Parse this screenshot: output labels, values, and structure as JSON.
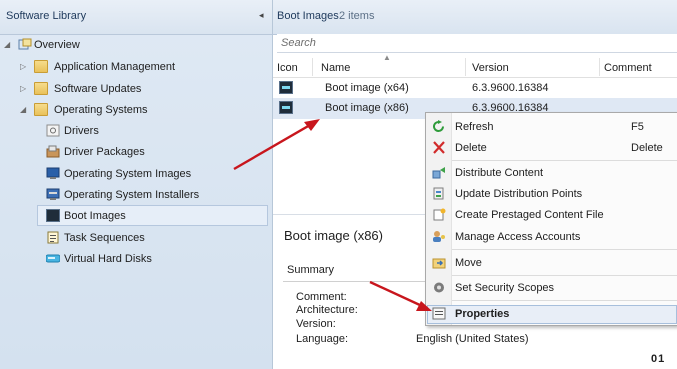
{
  "left_pane": {
    "title": "Software Library",
    "collapse_glyph": "◂",
    "tree": [
      {
        "label": "Overview",
        "icon": "overview-icon",
        "expander": "◢"
      },
      {
        "label": "Application Management",
        "icon": "folder-icon",
        "expander": "▷"
      },
      {
        "label": "Software Updates",
        "icon": "folder-icon",
        "expander": "▷"
      },
      {
        "label": "Operating Systems",
        "icon": "folder-icon",
        "expander": "◢"
      },
      {
        "label": "Drivers",
        "icon": "drivers-icon"
      },
      {
        "label": "Driver Packages",
        "icon": "driver-packages-icon"
      },
      {
        "label": "Operating System Images",
        "icon": "os-images-icon"
      },
      {
        "label": "Operating System Installers",
        "icon": "os-installers-icon"
      },
      {
        "label": "Boot Images",
        "icon": "boot-images-icon",
        "selected": true
      },
      {
        "label": "Task Sequences",
        "icon": "task-sequences-icon"
      },
      {
        "label": "Virtual Hard Disks",
        "icon": "virtual-hard-disk-icon"
      }
    ]
  },
  "right_pane": {
    "title": "Boot Images",
    "count": "2 items",
    "search_placeholder": "Search",
    "columns": [
      "Icon",
      "Name",
      "Version",
      "Comment"
    ],
    "rows": [
      {
        "name": "Boot image (x64)",
        "version": "6.3.9600.16384",
        "comment": ""
      },
      {
        "name": "Boot image (x86)",
        "version": "6.3.9600.16384",
        "comment": ""
      }
    ]
  },
  "details": {
    "title": "Boot image (x86)",
    "section": "Summary",
    "labels": [
      "Comment:",
      "Architecture:",
      "Version:",
      "Language:"
    ],
    "language_value": "English (United States)",
    "clipped_text": "01"
  },
  "context_menu": {
    "items": [
      {
        "label": "Refresh",
        "shortcut": "F5",
        "icon": "refresh-icon"
      },
      {
        "label": "Delete",
        "shortcut": "Delete",
        "icon": "delete-icon"
      },
      {
        "label": "Distribute Content",
        "icon": "distribute-content-icon"
      },
      {
        "label": "Update Distribution Points",
        "icon": "update-distribution-points-icon"
      },
      {
        "label": "Create Prestaged Content File",
        "icon": "prestaged-content-icon"
      },
      {
        "label": "Manage Access Accounts",
        "icon": "manage-access-accounts-icon"
      },
      {
        "label": "Move",
        "icon": "move-icon"
      },
      {
        "label": "Set Security Scopes",
        "icon": "security-scopes-icon"
      },
      {
        "label": "Properties",
        "icon": "properties-icon"
      }
    ]
  },
  "colors": {
    "annotation_arrow": "#c8161d",
    "left_pane_bg": "#d9e4f0",
    "selection_bg": "#e6eef8"
  }
}
